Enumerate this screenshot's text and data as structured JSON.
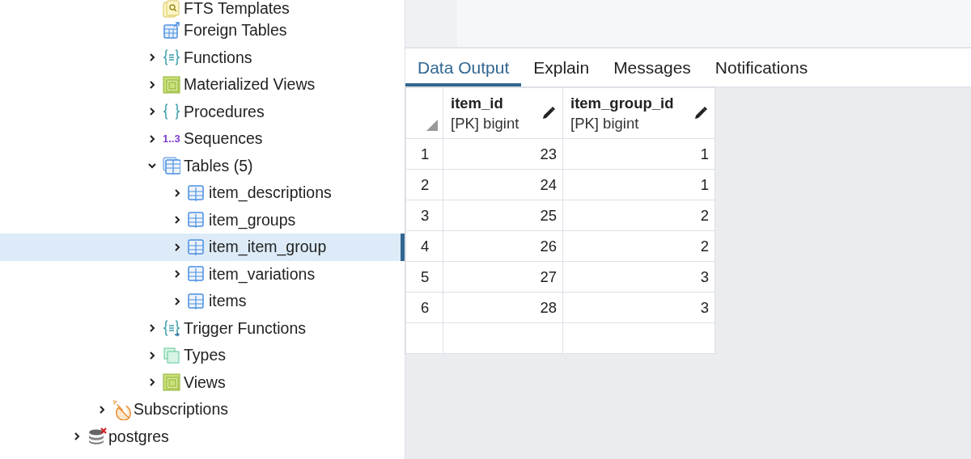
{
  "tree": [
    {
      "children": [
        {
          "children": [
            {
              "children": [
                {
                  "children": [
                    {
                      "label": "FTS Templates",
                      "kind": "fts-template",
                      "selected": false
                    },
                    {
                      "label": "Foreign Tables",
                      "kind": "foreign-table",
                      "selected": false
                    },
                    {
                      "label": "Functions",
                      "kind": "function",
                      "expandable": true,
                      "expanded": false,
                      "selected": false
                    },
                    {
                      "label": "Materialized Views",
                      "kind": "matview",
                      "expandable": true,
                      "expanded": false,
                      "selected": false
                    },
                    {
                      "label": "Procedures",
                      "kind": "procedure",
                      "expandable": true,
                      "expanded": false,
                      "selected": false
                    },
                    {
                      "label": "Sequences",
                      "kind": "sequence",
                      "badge": "1..3",
                      "expandable": true,
                      "expanded": false,
                      "selected": false
                    },
                    {
                      "label": "Tables (5)",
                      "kind": "tables",
                      "expandable": true,
                      "expanded": true,
                      "selected": false,
                      "children": [
                        {
                          "label": "item_descriptions",
                          "kind": "table",
                          "expandable": true,
                          "expanded": false,
                          "selected": false
                        },
                        {
                          "label": "item_groups",
                          "kind": "table",
                          "expandable": true,
                          "expanded": false,
                          "selected": false
                        },
                        {
                          "label": "item_item_group",
                          "kind": "table",
                          "expandable": true,
                          "expanded": false,
                          "selected": true
                        },
                        {
                          "label": "item_variations",
                          "kind": "table",
                          "expandable": true,
                          "expanded": false,
                          "selected": false
                        },
                        {
                          "label": "items",
                          "kind": "table",
                          "expandable": true,
                          "expanded": false,
                          "selected": false
                        }
                      ]
                    },
                    {
                      "label": "Trigger Functions",
                      "kind": "trigger-function",
                      "expandable": true,
                      "expanded": false,
                      "selected": false
                    },
                    {
                      "label": "Types",
                      "kind": "type",
                      "expandable": true,
                      "expanded": false,
                      "selected": false
                    },
                    {
                      "label": "Views",
                      "kind": "view",
                      "expandable": true,
                      "expanded": false,
                      "selected": false
                    }
                  ]
                }
              ]
            },
            {
              "label": "Subscriptions",
              "kind": "subscription",
              "expandable": true,
              "expanded": false,
              "selected": false
            }
          ]
        },
        {
          "label": "postgres",
          "kind": "database",
          "disconnected": true,
          "expandable": true,
          "expanded": false,
          "selected": false
        }
      ]
    }
  ],
  "tabs": [
    {
      "label": "Data Output",
      "selected": true
    },
    {
      "label": "Explain",
      "selected": false
    },
    {
      "label": "Messages",
      "selected": false
    },
    {
      "label": "Notifications",
      "selected": false
    }
  ],
  "grid": {
    "columns": [
      {
        "name": "item_id",
        "type": "[PK] bigint"
      },
      {
        "name": "item_group_id",
        "type": "[PK] bigint"
      }
    ],
    "rows": [
      {
        "number": "1",
        "cells": [
          "23",
          "1"
        ]
      },
      {
        "number": "2",
        "cells": [
          "24",
          "1"
        ]
      },
      {
        "number": "3",
        "cells": [
          "25",
          "2"
        ]
      },
      {
        "number": "4",
        "cells": [
          "26",
          "2"
        ]
      },
      {
        "number": "5",
        "cells": [
          "27",
          "3"
        ]
      },
      {
        "number": "6",
        "cells": [
          "28",
          "3"
        ]
      }
    ]
  }
}
